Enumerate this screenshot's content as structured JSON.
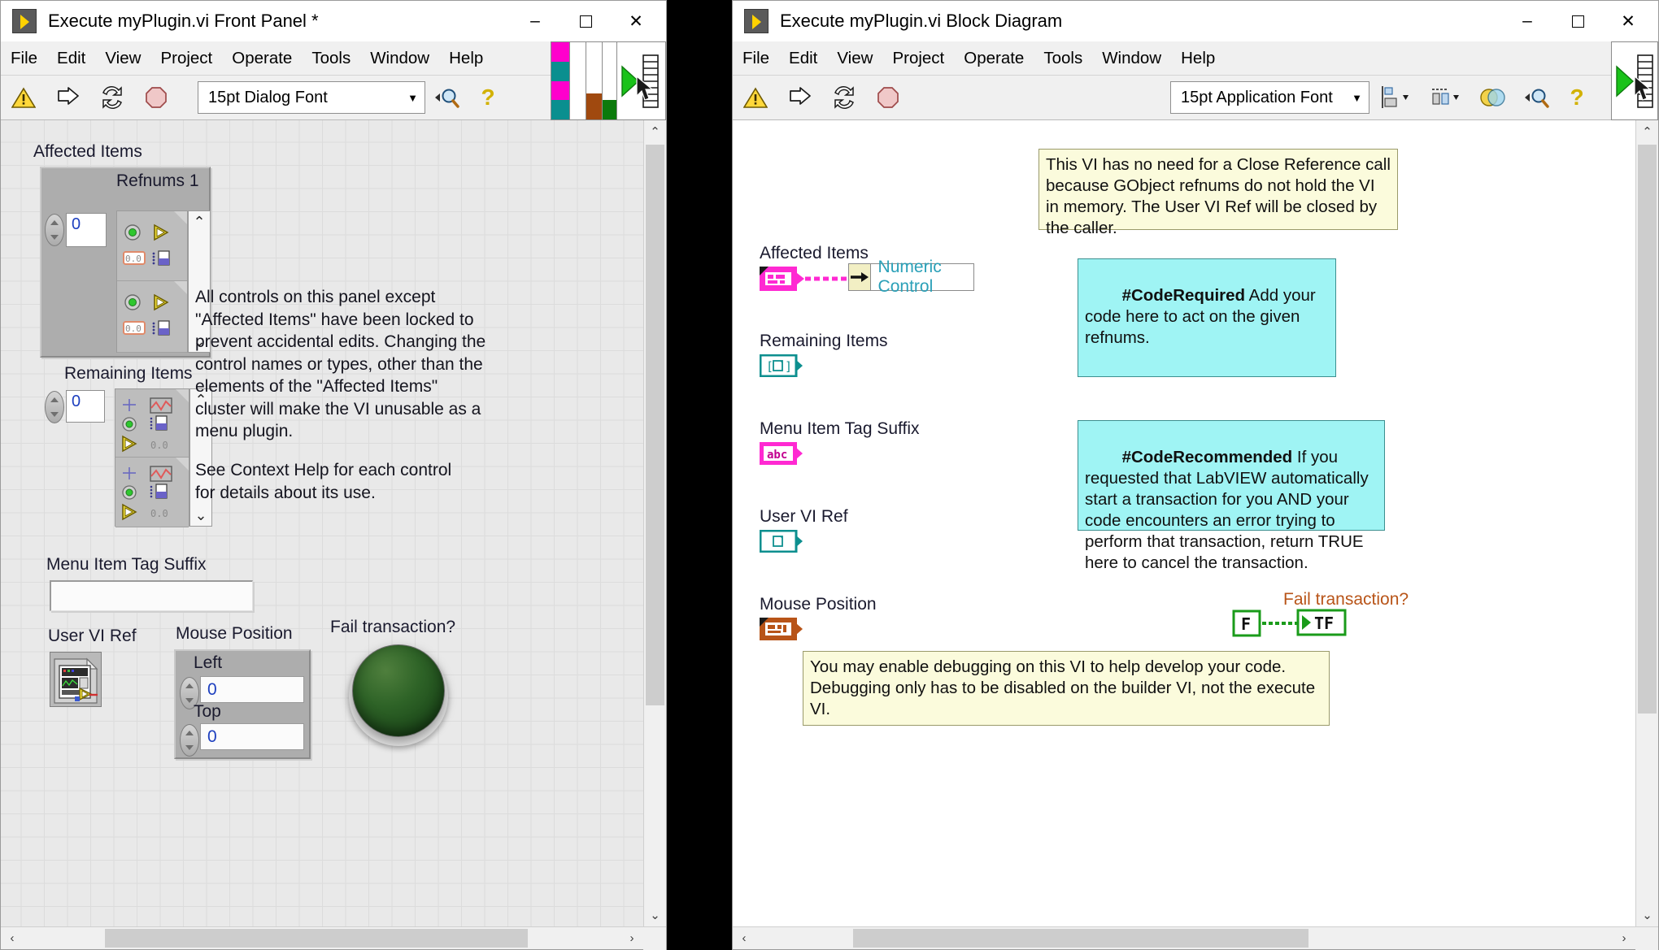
{
  "front_panel": {
    "title": "Execute myPlugin.vi Front Panel *",
    "window_buttons": {
      "minimize": "–",
      "maximize": "□",
      "close": "✕"
    },
    "menus": [
      "File",
      "Edit",
      "View",
      "Project",
      "Operate",
      "Tools",
      "Window",
      "Help"
    ],
    "toolbar": {
      "font_selector": "15pt Dialog Font",
      "caret": "▼",
      "icons": [
        "warning-icon",
        "run-icon",
        "run-continuously-icon",
        "abort-icon",
        "search-icon",
        "context-help-icon"
      ]
    },
    "controls": {
      "affected_items": {
        "label": "Affected Items",
        "inner_label": "Refnums 1",
        "index_value": "0",
        "scroll_up": "⌃",
        "scroll_down": "⌄"
      },
      "remaining_items": {
        "label": "Remaining Items",
        "index_value": "0",
        "scroll_up": "⌃",
        "scroll_down": "⌄"
      },
      "menu_item_tag_suffix": {
        "label": "Menu Item Tag Suffix",
        "value": ""
      },
      "user_vi_ref": {
        "label": "User VI Ref"
      },
      "mouse_position": {
        "label": "Mouse Position",
        "left_label": "Left",
        "left_value": "0",
        "top_label": "Top",
        "top_value": "0"
      },
      "fail_transaction": {
        "label": "Fail transaction?",
        "state": "off"
      }
    },
    "notes": {
      "locked_note": "All controls on this panel except \"Affected Items\" have been locked to prevent accidental edits. Changing the control names or types, other than the elements of the \"Affected Items\" cluster will make the VI unusable as a menu plugin.",
      "help_note": "See Context Help for each control for details about its use."
    },
    "scroll": {
      "left_arrow": "‹",
      "right_arrow": "›",
      "up_arrow": "⌃",
      "down_arrow": "⌄"
    }
  },
  "block_diagram": {
    "title": "Execute myPlugin.vi Block Diagram",
    "window_buttons": {
      "minimize": "–",
      "maximize": "□",
      "close": "✕"
    },
    "menus": [
      "File",
      "Edit",
      "View",
      "Project",
      "Operate",
      "Tools",
      "Window",
      "Help"
    ],
    "toolbar": {
      "font_selector": "15pt Application Font",
      "caret": "▼",
      "icons": [
        "warning-icon",
        "run-icon",
        "run-continuously-icon",
        "abort-icon",
        "align-objects-icon",
        "distribute-objects-icon",
        "reorder-icon",
        "search-icon",
        "context-help-icon"
      ]
    },
    "terminals": [
      {
        "name": "affected-items-terminal",
        "label": "Affected Items",
        "glyph": "cluster",
        "color": "#ff29d2"
      },
      {
        "name": "remaining-items-terminal",
        "label": "Remaining Items",
        "glyph": "[ ⬚ ]",
        "color": "#0d8f8f"
      },
      {
        "name": "menu-item-tag-suffix-terminal",
        "label": "Menu Item Tag Suffix",
        "glyph": "abc",
        "color": "#ff29d2"
      },
      {
        "name": "user-vi-ref-terminal",
        "label": "User VI Ref",
        "glyph": "⬚",
        "color": "#0d8f8f"
      },
      {
        "name": "mouse-position-terminal",
        "label": "Mouse Position",
        "glyph": "cluster",
        "color": "#b85418"
      }
    ],
    "numeric_control_node": {
      "label": "Numeric Control"
    },
    "fail_transaction": {
      "label": "Fail transaction?",
      "false_constant": "F",
      "terminal_glyph": "TF",
      "color": "#1a9b1a"
    },
    "comments": [
      {
        "name": "close-reference-comment",
        "style": "yellow",
        "text": "This VI has no need for a Close Reference call because GObject refnums do not hold the VI in memory. The User VI Ref will be closed by the caller."
      },
      {
        "name": "code-required-comment",
        "style": "cyan",
        "bold_prefix": "#CodeRequired",
        "text": " Add your code here to act on the given refnums."
      },
      {
        "name": "code-recommended-comment",
        "style": "cyan",
        "bold_prefix": "#CodeRecommended",
        "text": " If you requested that LabVIEW automatically start a transaction for you AND your code encounters an error trying to perform that transaction, return TRUE here to cancel the transaction."
      },
      {
        "name": "debugging-comment",
        "style": "yellow",
        "text": "You may enable debugging on this VI to help develop your code. Debugging only has to be disabled on the builder VI, not the execute VI."
      }
    ],
    "scroll": {
      "left_arrow": "‹",
      "right_arrow": "›",
      "up_arrow": "⌃",
      "down_arrow": "⌄"
    }
  }
}
